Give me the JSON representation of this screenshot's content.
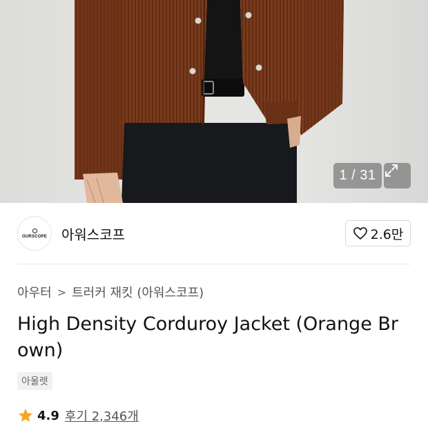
{
  "gallery": {
    "counter": "1 / 31",
    "expand_icon": "expand-icon"
  },
  "brand": {
    "logo_text": "OURSCOPE",
    "name": "아워스코프",
    "like_icon": "heart-icon",
    "like_count": "2.6만"
  },
  "breadcrumb": {
    "category": "아우터",
    "separator": ">",
    "subcategory": "트러커 재킷 (아워스코프)"
  },
  "product": {
    "title": "High Density Corduroy Jacket (Orange Brown)",
    "tag": "아울렛"
  },
  "rating": {
    "star_icon": "star-icon",
    "score": "4.9",
    "reviews": "후기 2,346개",
    "star_color": "#f5a623"
  }
}
